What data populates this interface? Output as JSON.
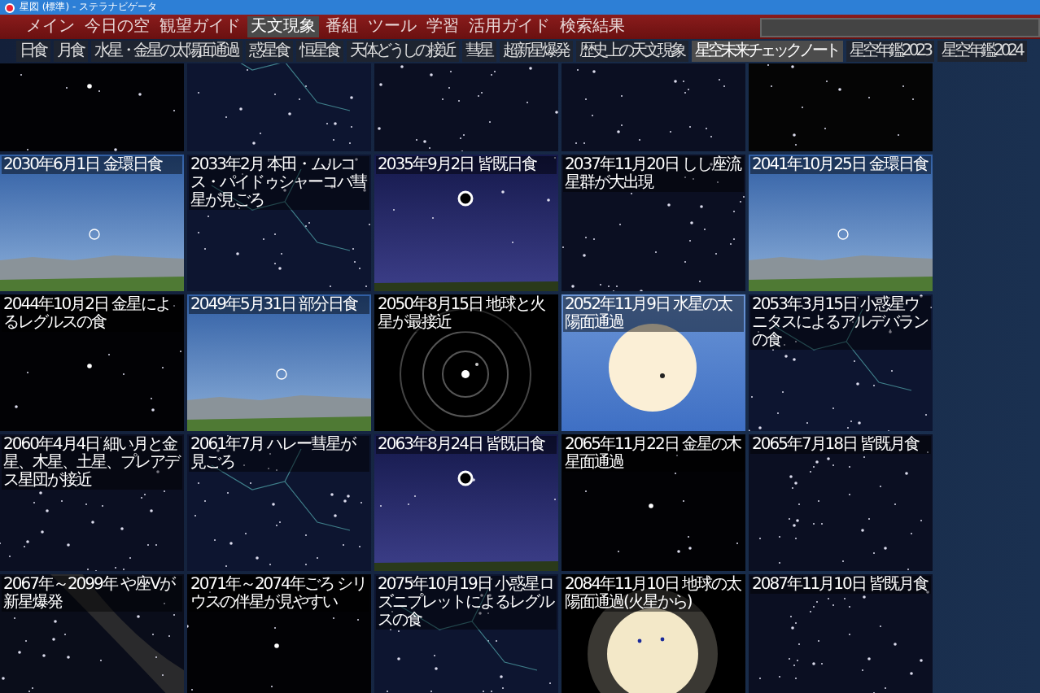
{
  "window": {
    "title": "星図 (標準) - ステラナビゲータ"
  },
  "menu": [
    {
      "label": "メイン",
      "selected": false
    },
    {
      "label": "今日の空",
      "selected": false
    },
    {
      "label": "観望ガイド",
      "selected": false
    },
    {
      "label": "天文現象",
      "selected": true
    },
    {
      "label": "番組",
      "selected": false
    },
    {
      "label": "ツール",
      "selected": false
    },
    {
      "label": "学習",
      "selected": false
    },
    {
      "label": "活用ガイド",
      "selected": false
    },
    {
      "label": "検索結果",
      "selected": false
    }
  ],
  "tabs": [
    {
      "label": "日食",
      "selected": false
    },
    {
      "label": "月食",
      "selected": false
    },
    {
      "label": "水星・金星の太陽面通過",
      "selected": false
    },
    {
      "label": "惑星食",
      "selected": false
    },
    {
      "label": "恒星食",
      "selected": false
    },
    {
      "label": "天体どうしの接近",
      "selected": false
    },
    {
      "label": "彗星",
      "selected": false
    },
    {
      "label": "超新星爆発",
      "selected": false
    },
    {
      "label": "歴史上の天文現象",
      "selected": false
    },
    {
      "label": "星空未来チェックノート",
      "selected": true
    },
    {
      "label": "星空年鑑2023",
      "selected": false
    },
    {
      "label": "星空年鑑2024",
      "selected": false
    }
  ],
  "tiles": [
    {
      "kind": "dark"
    },
    {
      "kind": "constellation"
    },
    {
      "kind": "night"
    },
    {
      "kind": "night"
    },
    {
      "kind": "moon"
    },
    {
      "kind": "day",
      "title": "2030年6月1日 金環日食"
    },
    {
      "kind": "constellation",
      "title": "2033年2月 本田・ムルコス・パイドゥシャーコバ彗星が見ごろ"
    },
    {
      "kind": "twilight",
      "title": "2035年9月2日 皆既日食"
    },
    {
      "kind": "night",
      "title": "2037年11月20日 しし座流星群が大出現"
    },
    {
      "kind": "day",
      "title": "2041年10月25日 金環日食"
    },
    {
      "kind": "dark",
      "title": "2044年10月2日 金星によるレグルスの食"
    },
    {
      "kind": "day",
      "title": "2049年5月31日 部分日食"
    },
    {
      "kind": "orbit",
      "title": "2050年8月15日 地球と火星が最接近"
    },
    {
      "kind": "sun",
      "title": "2052年11月9日 水星の太陽面通過"
    },
    {
      "kind": "constellation",
      "title": "2053年3月15日 小惑星ウニタスによるアルデバランの食"
    },
    {
      "kind": "night",
      "title": "2060年4月4日 細い月と金星、木星、土星、プレアデス星団が接近"
    },
    {
      "kind": "constellation",
      "title": "2061年7月 ハレー彗星が見ごろ"
    },
    {
      "kind": "twilight",
      "title": "2063年8月24日 皆既日食"
    },
    {
      "kind": "dark",
      "title": "2065年11月22日 金星の木星面通過"
    },
    {
      "kind": "night",
      "title": "2065年7月18日 皆既月食"
    },
    {
      "kind": "milkyway",
      "title": "2067年～2099年 や座Vが新星爆発"
    },
    {
      "kind": "dark",
      "title": "2071年～2074年ごろ シリウスの伴星が見やすい"
    },
    {
      "kind": "constellation",
      "title": "2075年10月19日 小惑星ロズニプレットによるレグルスの食"
    },
    {
      "kind": "glow",
      "title": "2084年11月10日 地球の太陽面通過(火星から)"
    },
    {
      "kind": "night",
      "title": "2087年11月10日 皆既月食"
    }
  ]
}
